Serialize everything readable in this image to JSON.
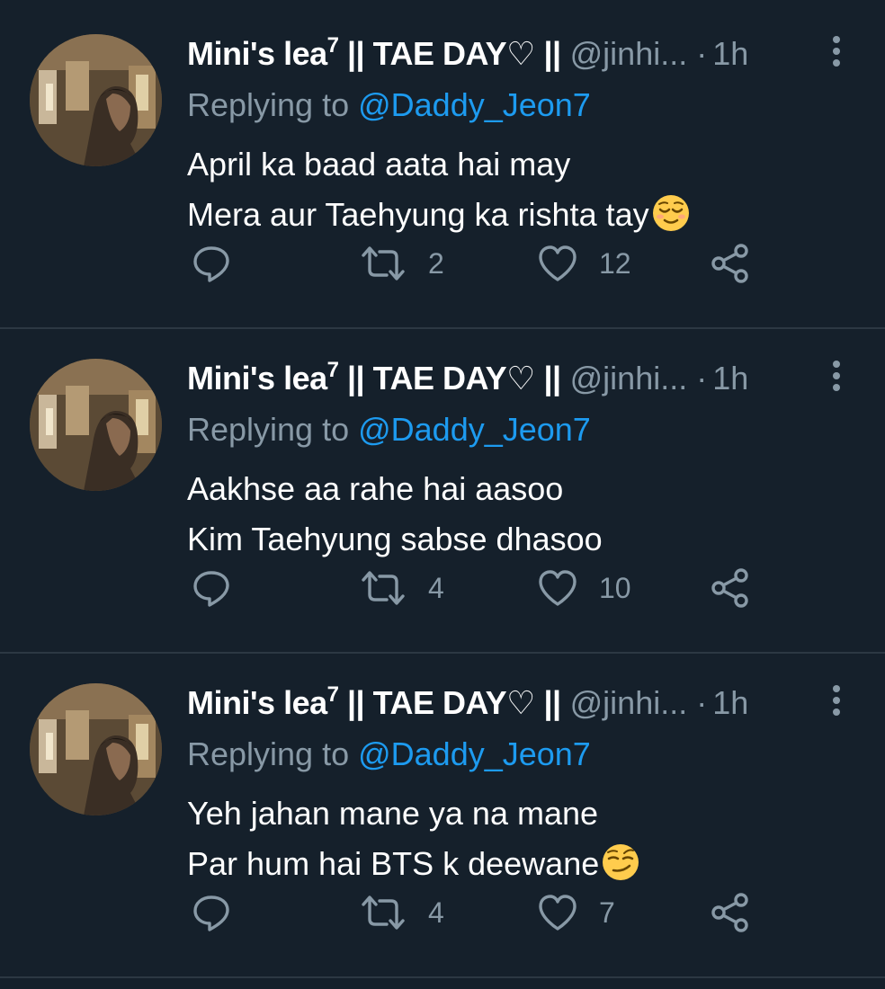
{
  "tweets": [
    {
      "name": "Mini's lea",
      "name_superscript": "7",
      "name_suffix": " || TAE DAY",
      "name_heart": "♡",
      "name_end": " ||",
      "handle": "@jinhi...",
      "separator": "·",
      "time": "1h",
      "replying_label": "Replying to ",
      "replying_to": "@Daddy_Jeon7",
      "lines": [
        "April ka baad aata hai may",
        "Mera aur Taehyung ka rishta tay"
      ],
      "emoji": "relieved-face-emoji",
      "retweets": "2",
      "likes": "12"
    },
    {
      "name": "Mini's lea",
      "name_superscript": "7",
      "name_suffix": " || TAE DAY",
      "name_heart": "♡",
      "name_end": " ||",
      "handle": "@jinhi...",
      "separator": "·",
      "time": "1h",
      "replying_label": "Replying to ",
      "replying_to": "@Daddy_Jeon7",
      "lines": [
        "Aakhse aa rahe hai aasoo",
        "Kim Taehyung sabse dhasoo"
      ],
      "emoji": null,
      "retweets": "4",
      "likes": "10"
    },
    {
      "name": "Mini's lea",
      "name_superscript": "7",
      "name_suffix": " || TAE DAY",
      "name_heart": "♡",
      "name_end": " ||",
      "handle": "@jinhi...",
      "separator": "·",
      "time": "1h",
      "replying_label": "Replying to ",
      "replying_to": "@Daddy_Jeon7",
      "lines": [
        "Yeh jahan mane ya na mane",
        "Par hum hai BTS k deewane"
      ],
      "emoji": "smirking-face-emoji",
      "retweets": "4",
      "likes": "7"
    }
  ],
  "colors": {
    "background": "#15202b",
    "text": "#ffffff",
    "secondary": "#8899a6",
    "link": "#1d9bf0",
    "divider": "#2c3843"
  }
}
